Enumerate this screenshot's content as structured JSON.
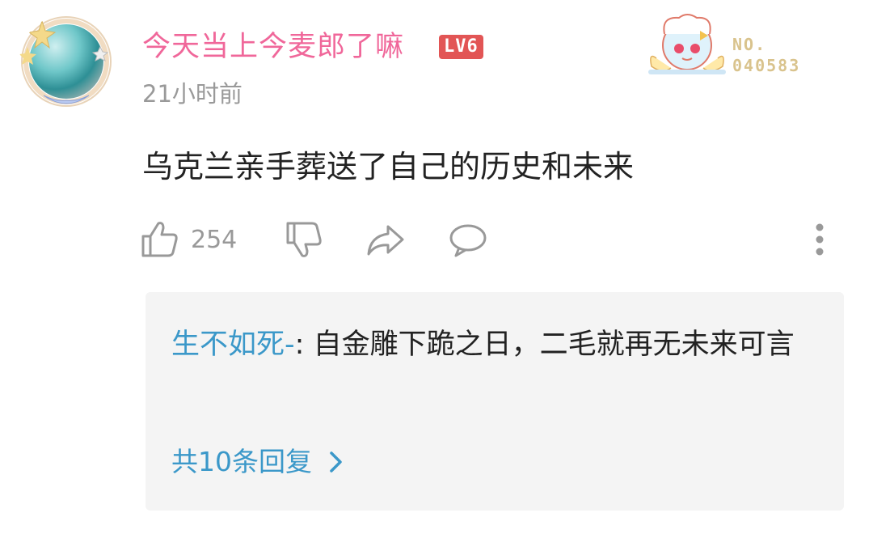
{
  "comment": {
    "author": "今天当上今麦郎了嘛",
    "level": "LV6",
    "time": "21小时前",
    "fan_badge_label": "NO.",
    "fan_badge_number": "040583",
    "text": "乌克兰亲手葬送了自己的历史和未来",
    "like_count": "254"
  },
  "reply": {
    "author": "生不如死-",
    "separator": ":",
    "text": " 自金雕下跪之日，二毛就再无未来可言",
    "view_all": "共10条回复"
  },
  "colors": {
    "author_pink": "#f0679a",
    "level_red": "#e25555",
    "link_blue": "#3b98c9",
    "muted_gray": "#999999",
    "reply_bg": "#f4f4f4"
  },
  "icons": [
    "thumbs-up-icon",
    "thumbs-down-icon",
    "share-icon",
    "comment-icon",
    "more-vertical-icon",
    "chevron-right-icon"
  ]
}
